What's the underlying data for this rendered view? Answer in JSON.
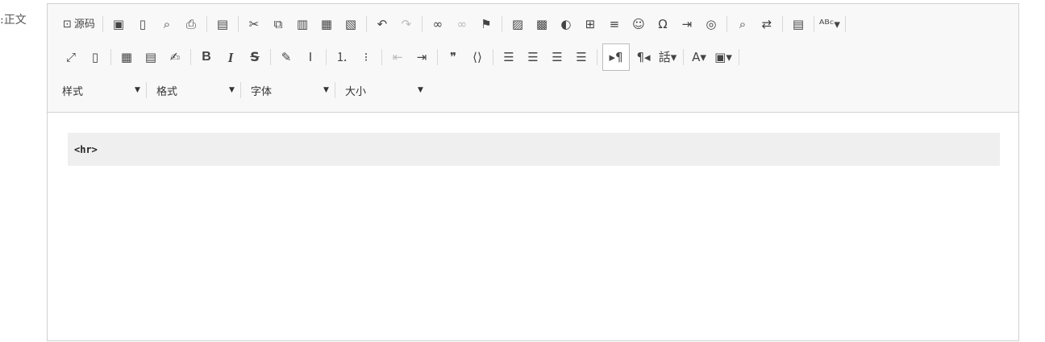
{
  "field": {
    "label": "正文:"
  },
  "toolbar": {
    "row1": [
      {
        "name": "source-button",
        "icon": "source-icon",
        "glyph": "⊡",
        "label": "源码"
      },
      {
        "sep": true
      },
      {
        "name": "save-button",
        "icon": "save-icon",
        "glyph": "▣"
      },
      {
        "name": "new-page-button",
        "icon": "new-page-icon",
        "glyph": "▯"
      },
      {
        "name": "preview-button",
        "icon": "preview-icon",
        "glyph": "⌕"
      },
      {
        "name": "print-button",
        "icon": "print-icon",
        "glyph": "⎙"
      },
      {
        "sep": true
      },
      {
        "name": "templates-button",
        "icon": "templates-icon",
        "glyph": "▤"
      },
      {
        "sep": true
      },
      {
        "name": "cut-button",
        "icon": "scissors-icon",
        "glyph": "✂"
      },
      {
        "name": "copy-button",
        "icon": "copy-icon",
        "glyph": "⧉"
      },
      {
        "name": "paste-button",
        "icon": "paste-icon",
        "glyph": "▥"
      },
      {
        "name": "paste-text-button",
        "icon": "paste-text-icon",
        "glyph": "▦"
      },
      {
        "name": "paste-word-button",
        "icon": "paste-word-icon",
        "glyph": "▧"
      },
      {
        "sep": true
      },
      {
        "name": "undo-button",
        "icon": "undo-icon",
        "glyph": "↶"
      },
      {
        "name": "redo-button",
        "icon": "redo-icon",
        "glyph": "↷",
        "dim": true
      },
      {
        "sep": true
      },
      {
        "name": "link-button",
        "icon": "link-icon",
        "glyph": "∞"
      },
      {
        "name": "unlink-button",
        "icon": "unlink-icon",
        "glyph": "∞",
        "dim": true
      },
      {
        "name": "anchor-button",
        "icon": "flag-icon",
        "glyph": "⚑"
      },
      {
        "sep": true
      },
      {
        "name": "image-button",
        "icon": "image-icon",
        "glyph": "▨"
      },
      {
        "name": "flash-button",
        "icon": "flash-icon",
        "glyph": "▩"
      },
      {
        "name": "iframe-button",
        "icon": "compass-icon",
        "glyph": "◐"
      },
      {
        "name": "table-button",
        "icon": "table-icon",
        "glyph": "⊞"
      },
      {
        "name": "horizontal-rule-button",
        "icon": "horizontal-rule-icon",
        "glyph": "≡"
      },
      {
        "name": "smiley-button",
        "icon": "smiley-icon",
        "glyph": "☺"
      },
      {
        "name": "special-char-button",
        "icon": "omega-icon",
        "glyph": "Ω"
      },
      {
        "name": "page-break-button",
        "icon": "page-break-icon",
        "glyph": "⇥"
      },
      {
        "name": "globe-button",
        "icon": "globe-icon",
        "glyph": "◎"
      },
      {
        "sep": true
      },
      {
        "name": "find-button",
        "icon": "search-icon",
        "glyph": "⌕"
      },
      {
        "name": "replace-button",
        "icon": "replace-icon",
        "glyph": "⇄"
      },
      {
        "sep": true
      },
      {
        "name": "select-all-button",
        "icon": "select-all-icon",
        "glyph": "▤"
      },
      {
        "sep": true
      },
      {
        "name": "spellcheck-button",
        "icon": "spellcheck-icon",
        "glyph": "ᴬᴮᶜ▾"
      },
      {
        "sep": true
      }
    ],
    "row2": [
      {
        "name": "maximize-button",
        "icon": "maximize-icon",
        "glyph": "⤢"
      },
      {
        "name": "show-blocks-button",
        "icon": "show-blocks-icon",
        "glyph": "▯"
      },
      {
        "sep": true
      },
      {
        "name": "video-button",
        "icon": "clapperboard-icon",
        "glyph": "▦"
      },
      {
        "name": "film-button",
        "icon": "film-icon",
        "glyph": "▤"
      },
      {
        "name": "signature-button",
        "icon": "signature-icon",
        "glyph": "✍"
      },
      {
        "sep": true
      },
      {
        "name": "bold-button",
        "icon": "bold-icon",
        "glyph": "B",
        "cls": "bold-b"
      },
      {
        "name": "italic-button",
        "icon": "italic-icon",
        "glyph": "I",
        "cls": "ital-i"
      },
      {
        "name": "strike-button",
        "icon": "strikethrough-icon",
        "glyph": "S",
        "cls": "strike-s"
      },
      {
        "sep": true
      },
      {
        "name": "copy-format-button",
        "icon": "brush-icon",
        "glyph": "✎"
      },
      {
        "name": "remove-format-button",
        "icon": "remove-format-icon",
        "glyph": "Ⅰ"
      },
      {
        "sep": true
      },
      {
        "name": "numbered-list-button",
        "icon": "numbered-list-icon",
        "glyph": "⒈"
      },
      {
        "name": "bulleted-list-button",
        "icon": "bulleted-list-icon",
        "glyph": "⁝"
      },
      {
        "sep": true
      },
      {
        "name": "outdent-button",
        "icon": "outdent-icon",
        "glyph": "⇤",
        "dim": true
      },
      {
        "name": "indent-button",
        "icon": "indent-icon",
        "glyph": "⇥"
      },
      {
        "sep": true
      },
      {
        "name": "blockquote-button",
        "icon": "quote-icon",
        "glyph": "❞"
      },
      {
        "name": "div-button",
        "icon": "div-icon",
        "glyph": "⟨⟩"
      },
      {
        "sep": true
      },
      {
        "name": "align-left-button",
        "icon": "align-left-icon",
        "glyph": "☰"
      },
      {
        "name": "align-center-button",
        "icon": "align-center-icon",
        "glyph": "☰"
      },
      {
        "name": "align-right-button",
        "icon": "align-right-icon",
        "glyph": "☰"
      },
      {
        "name": "align-justify-button",
        "icon": "align-justify-icon",
        "glyph": "☰"
      },
      {
        "sep": true
      },
      {
        "name": "ltr-button",
        "icon": "ltr-icon",
        "glyph": "▸¶",
        "active": true
      },
      {
        "name": "rtl-button",
        "icon": "rtl-icon",
        "glyph": "¶◂"
      },
      {
        "name": "language-button",
        "icon": "language-icon",
        "glyph": "話▾"
      },
      {
        "sep": true
      },
      {
        "name": "text-color-button",
        "icon": "text-color-icon",
        "glyph": "A▾"
      },
      {
        "name": "bg-color-button",
        "icon": "bg-color-icon",
        "glyph": "▣▾"
      },
      {
        "sep": true
      }
    ],
    "combos": [
      {
        "name": "styles-combo",
        "label": "样式",
        "width": 100
      },
      {
        "name": "format-combo",
        "label": "格式",
        "width": 100
      },
      {
        "name": "font-combo",
        "label": "字体",
        "width": 100
      },
      {
        "name": "size-combo",
        "label": "大小",
        "width": 100
      }
    ]
  },
  "content": {
    "code": "<hr>"
  }
}
